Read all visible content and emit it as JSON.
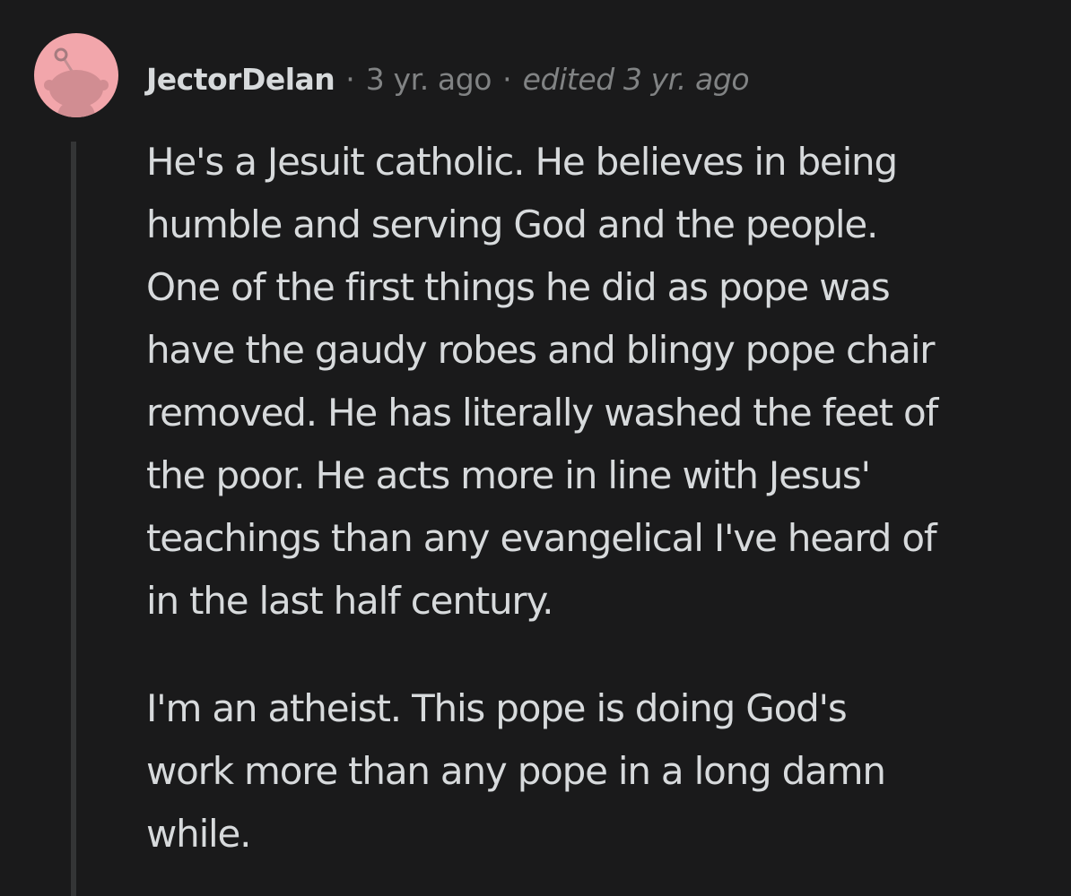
{
  "comment": {
    "author": "JectorDelan",
    "separator": "·",
    "timestamp": "3 yr. ago",
    "edited": "edited 3 yr. ago",
    "avatar_icon": "snoo-avatar-icon",
    "avatar_color": "#f2a6ab",
    "paragraphs": [
      {
        "lines": [
          "He's a Jesuit catholic. He believes in being",
          "humble and serving God and the people.",
          "One of the first things he did as pope was",
          "have the gaudy robes and blingy pope chair",
          "removed. He has literally washed the feet of",
          "the poor. He acts more in line with Jesus'",
          "teachings than any evangelical I've heard of",
          "in the last half century."
        ]
      },
      {
        "lines": [
          "I'm an atheist. This pope is doing God's",
          "work more than any pope in a long damn",
          "while."
        ]
      }
    ]
  }
}
